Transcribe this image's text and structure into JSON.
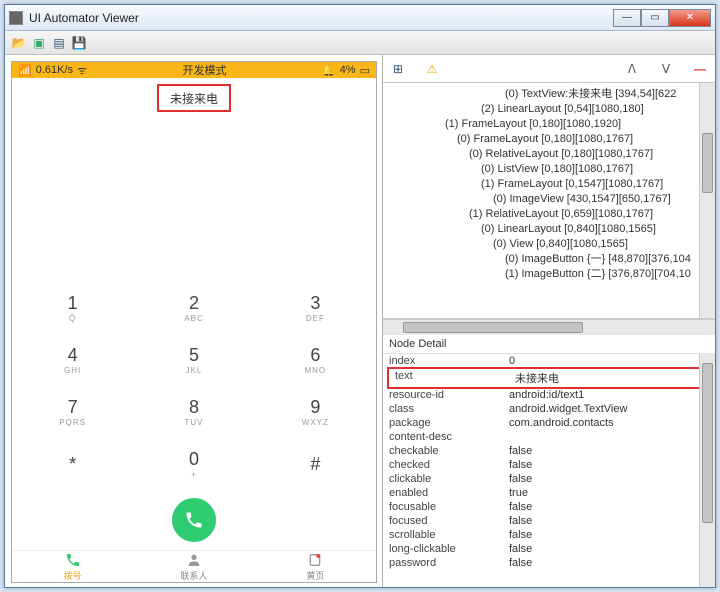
{
  "window": {
    "title": "UI Automator Viewer"
  },
  "device": {
    "status": {
      "left": "0.61K/s",
      "center": "开发模式",
      "right": "4%"
    },
    "selected_tab": "未接来电",
    "keypad": [
      {
        "n": "1",
        "s": "Q̊"
      },
      {
        "n": "2",
        "s": "ABC"
      },
      {
        "n": "3",
        "s": "DEF"
      },
      {
        "n": "4",
        "s": "GHI"
      },
      {
        "n": "5",
        "s": "JKL"
      },
      {
        "n": "6",
        "s": "MNO"
      },
      {
        "n": "7",
        "s": "PQRS"
      },
      {
        "n": "8",
        "s": "TUV"
      },
      {
        "n": "9",
        "s": "WXYZ"
      },
      {
        "n": "*",
        "s": ""
      },
      {
        "n": "0",
        "s": "+"
      },
      {
        "n": "#",
        "s": ""
      }
    ],
    "tabs": [
      {
        "label": "拨号"
      },
      {
        "label": "联系人"
      },
      {
        "label": "黄页"
      }
    ]
  },
  "tree": [
    {
      "indent": 10,
      "text": "(0) TextView:未接来电 [394,54][622"
    },
    {
      "indent": 8,
      "text": "(2) LinearLayout [0,54][1080,180]"
    },
    {
      "indent": 5,
      "text": "(1) FrameLayout [0,180][1080,1920]"
    },
    {
      "indent": 6,
      "text": "(0) FrameLayout [0,180][1080,1767]"
    },
    {
      "indent": 7,
      "text": "(0) RelativeLayout [0,180][1080,1767]"
    },
    {
      "indent": 8,
      "text": "(0) ListView [0,180][1080,1767]"
    },
    {
      "indent": 8,
      "text": "(1) FrameLayout [0,1547][1080,1767]"
    },
    {
      "indent": 9,
      "text": "(0) ImageView [430,1547][650,1767]"
    },
    {
      "indent": 7,
      "text": "(1) RelativeLayout [0,659][1080,1767]"
    },
    {
      "indent": 8,
      "text": "(0) LinearLayout [0,840][1080,1565]"
    },
    {
      "indent": 9,
      "text": "(0) View [0,840][1080,1565]"
    },
    {
      "indent": 10,
      "text": "(0) ImageButton {一} [48,870][376,104"
    },
    {
      "indent": 10,
      "text": "(1) ImageButton {二} [376,870][704,10"
    }
  ],
  "detail": {
    "title": "Node Detail",
    "rows": [
      {
        "k": "index",
        "v": "0"
      },
      {
        "k": "text",
        "v": "未接来电",
        "hl": true
      },
      {
        "k": "resource-id",
        "v": "android:id/text1"
      },
      {
        "k": "class",
        "v": "android.widget.TextView"
      },
      {
        "k": "package",
        "v": "com.android.contacts"
      },
      {
        "k": "content-desc",
        "v": ""
      },
      {
        "k": "checkable",
        "v": "false"
      },
      {
        "k": "checked",
        "v": "false"
      },
      {
        "k": "clickable",
        "v": "false"
      },
      {
        "k": "enabled",
        "v": "true"
      },
      {
        "k": "focusable",
        "v": "false"
      },
      {
        "k": "focused",
        "v": "false"
      },
      {
        "k": "scrollable",
        "v": "false"
      },
      {
        "k": "long-clickable",
        "v": "false"
      },
      {
        "k": "password",
        "v": "false"
      }
    ]
  },
  "icons": {
    "plus": "⊞",
    "warn": "⚠",
    "up": "ᐱ",
    "down": "ᐯ",
    "minus": "—"
  }
}
